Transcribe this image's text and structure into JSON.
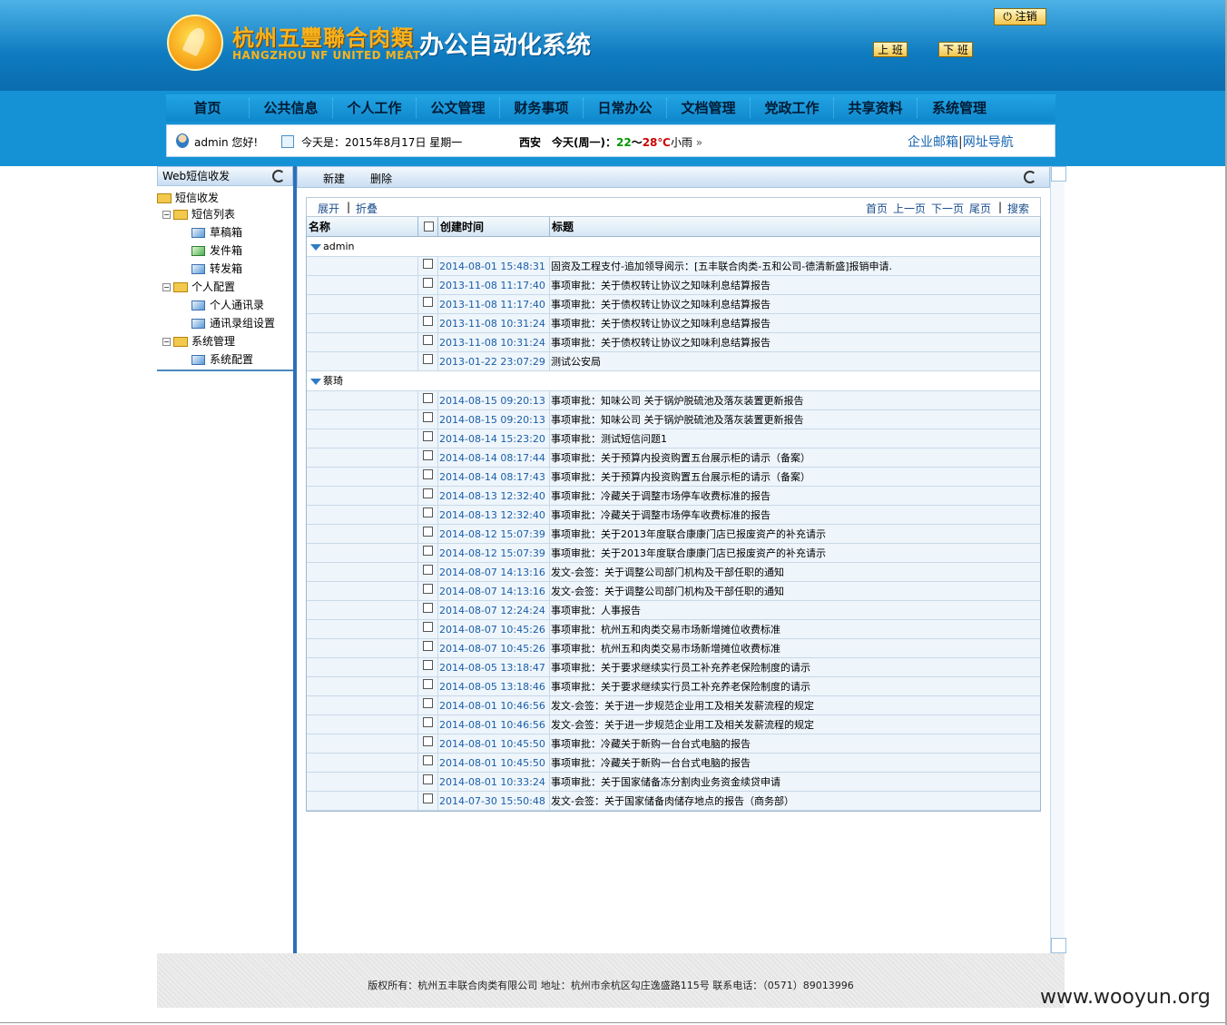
{
  "header": {
    "company_cn": "杭州五豐聯合肉類",
    "company_en": "HANGZHOU NF UNITED MEAT",
    "system_title": "办公自动化系统",
    "logout": "注销",
    "on_duty": "上 班",
    "off_duty": "下 班"
  },
  "nav": [
    "首页",
    "公共信息",
    "个人工作",
    "公文管理",
    "财务事项",
    "日常办公",
    "文档管理",
    "党政工作",
    "共享资料",
    "系统管理"
  ],
  "infobar": {
    "greeting": "admin 您好!",
    "date": "今天是：2015年8月17日 星期一",
    "city": "西安",
    "weather_prefix": "今天(周一)：",
    "temp_low": "22",
    "tilde": "～",
    "temp_high": "28℃",
    "weather_desc": "小雨",
    "more": "»",
    "link_mail": "企业邮箱",
    "link_sep": "|",
    "link_nav": "网址导航"
  },
  "colors": {
    "temp_low": "#009900",
    "temp_high": "#cc0000",
    "accent": "#1592d5"
  },
  "leftpanel": {
    "title": "Web短信收发",
    "tree": {
      "root": "短信收发",
      "sms_list": "短信列表",
      "drafts": "草稿箱",
      "outbox": "发件箱",
      "forwarded": "转发箱",
      "personal_config": "个人配置",
      "address_book": "个人通讯录",
      "address_group": "通讯录组设置",
      "system_mgmt": "系统管理",
      "system_config": "系统配置"
    }
  },
  "toolbar": {
    "new": "新建",
    "delete": "删除"
  },
  "pager": {
    "expand": "展开",
    "sep": "|",
    "collapse": "折叠",
    "first": "首页",
    "prev": "上一页",
    "next": "下一页",
    "last": "尾页",
    "search": "搜索"
  },
  "grid": {
    "columns": [
      "名称",
      "",
      "创建时间",
      "标题"
    ],
    "groups": [
      {
        "name": "admin",
        "rows": [
          {
            "time": "2014-08-01 15:48:31",
            "title": "固资及工程支付-追加领导阅示：[五丰联合肉类-五和公司-德清新盛]报销申请."
          },
          {
            "time": "2013-11-08 11:17:40",
            "title": "事项审批：关于债权转让协议之知味利息结算报告"
          },
          {
            "time": "2013-11-08 11:17:40",
            "title": "事项审批：关于债权转让协议之知味利息结算报告"
          },
          {
            "time": "2013-11-08 10:31:24",
            "title": "事项审批：关于债权转让协议之知味利息结算报告"
          },
          {
            "time": "2013-11-08 10:31:24",
            "title": "事项审批：关于债权转让协议之知味利息结算报告"
          },
          {
            "time": "2013-01-22 23:07:29",
            "title": "测试公安局"
          }
        ]
      },
      {
        "name": "蔡琦",
        "rows": [
          {
            "time": "2014-08-15 09:20:13",
            "title": "事项审批：知味公司 关于锅炉脱硫池及落灰装置更新报告"
          },
          {
            "time": "2014-08-15 09:20:13",
            "title": "事项审批：知味公司 关于锅炉脱硫池及落灰装置更新报告"
          },
          {
            "time": "2014-08-14 15:23:20",
            "title": "事项审批：测试短信问题1"
          },
          {
            "time": "2014-08-14 08:17:44",
            "title": "事项审批：关于预算内投资购置五台展示柜的请示（备案）"
          },
          {
            "time": "2014-08-14 08:17:43",
            "title": "事项审批：关于预算内投资购置五台展示柜的请示（备案）"
          },
          {
            "time": "2014-08-13 12:32:40",
            "title": "事项审批：冷藏关于调整市场停车收费标准的报告"
          },
          {
            "time": "2014-08-13 12:32:40",
            "title": "事项审批：冷藏关于调整市场停车收费标准的报告"
          },
          {
            "time": "2014-08-12 15:07:39",
            "title": "事项审批：关于2013年度联合康康门店已报废资产的补充请示"
          },
          {
            "time": "2014-08-12 15:07:39",
            "title": "事项审批：关于2013年度联合康康门店已报废资产的补充请示"
          },
          {
            "time": "2014-08-07 14:13:16",
            "title": "发文-会签：关于调整公司部门机构及干部任职的通知"
          },
          {
            "time": "2014-08-07 14:13:16",
            "title": "发文-会签：关于调整公司部门机构及干部任职的通知"
          },
          {
            "time": "2014-08-07 12:24:24",
            "title": "事项审批：人事报告"
          },
          {
            "time": "2014-08-07 10:45:26",
            "title": "事项审批：杭州五和肉类交易市场新增摊位收费标准"
          },
          {
            "time": "2014-08-07 10:45:26",
            "title": "事项审批：杭州五和肉类交易市场新增摊位收费标准"
          },
          {
            "time": "2014-08-05 13:18:47",
            "title": "事项审批：关于要求继续实行员工补充养老保险制度的请示"
          },
          {
            "time": "2014-08-05 13:18:46",
            "title": "事项审批：关于要求继续实行员工补充养老保险制度的请示"
          },
          {
            "time": "2014-08-01 10:46:56",
            "title": "发文-会签：关于进一步规范企业用工及相关发薪流程的规定"
          },
          {
            "time": "2014-08-01 10:46:56",
            "title": "发文-会签：关于进一步规范企业用工及相关发薪流程的规定"
          },
          {
            "time": "2014-08-01 10:45:50",
            "title": "事项审批：冷藏关于新购一台台式电脑的报告"
          },
          {
            "time": "2014-08-01 10:45:50",
            "title": "事项审批：冷藏关于新购一台台式电脑的报告"
          },
          {
            "time": "2014-08-01 10:33:24",
            "title": "事项审批：关于国家储备冻分割肉业务资金续贷申请"
          },
          {
            "time": "2014-07-30 15:50:48",
            "title": "发文-会签：关于国家储备肉储存地点的报告（商务部）"
          }
        ]
      }
    ]
  },
  "footer": "版权所有：杭州五丰联合肉类有限公司 地址：杭州市余杭区勾庄逸盛路115号 联系电话：（0571）89013996",
  "watermark": "www.wooyun.org"
}
